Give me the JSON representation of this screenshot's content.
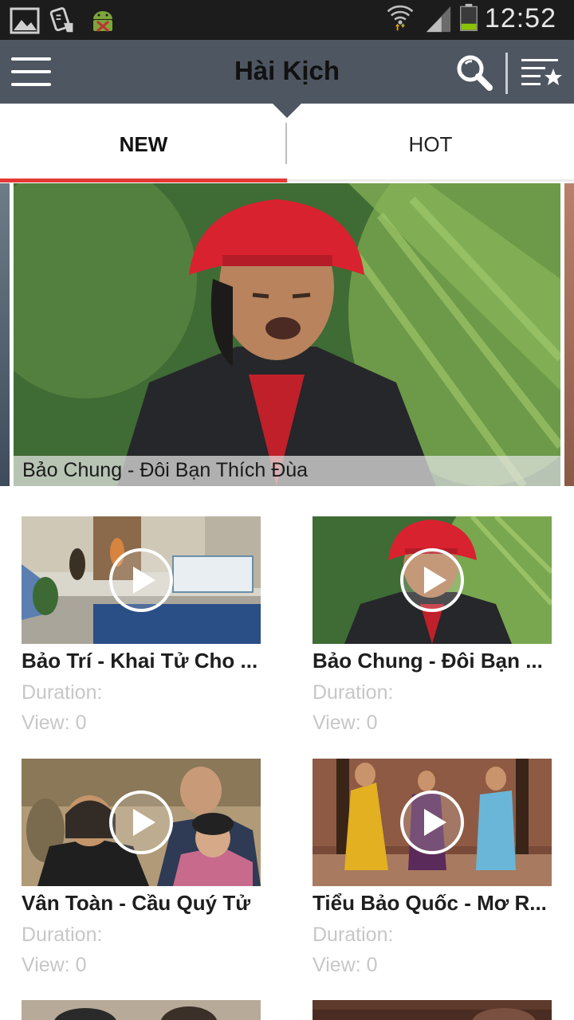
{
  "status_bar": {
    "time": "12:52",
    "icons": [
      "image-notification-icon",
      "download-notification-icon",
      "android-debug-icon",
      "wifi-icon",
      "signal-icon",
      "battery-icon"
    ]
  },
  "app_bar": {
    "title": "Hài Kịch",
    "icons": [
      "menu-icon",
      "search-icon",
      "favorites-list-icon"
    ]
  },
  "tabs": [
    {
      "label": "NEW",
      "selected": true
    },
    {
      "label": "HOT",
      "selected": false
    }
  ],
  "featured": {
    "caption": "Bảo Chung - Đôi Bạn Thích Đùa"
  },
  "videos": [
    {
      "title": "Bảo Trí - Khai Tử Cho ...",
      "duration": "Duration:",
      "views": "View: 0"
    },
    {
      "title": "Bảo Chung - Đôi Bạn ...",
      "duration": "Duration:",
      "views": "View: 0"
    },
    {
      "title": "Vân Toàn - Cầu Quý Tử",
      "duration": "Duration:",
      "views": "View: 0"
    },
    {
      "title": "Tiểu Bảo Quốc - Mơ R...",
      "duration": "Duration:",
      "views": "View: 0"
    }
  ],
  "colors": {
    "app_bar": "#4e5662",
    "status_bar": "#1c1c1c",
    "tab_indicator": "#e53935",
    "meta_text": "#c7c7c7"
  }
}
